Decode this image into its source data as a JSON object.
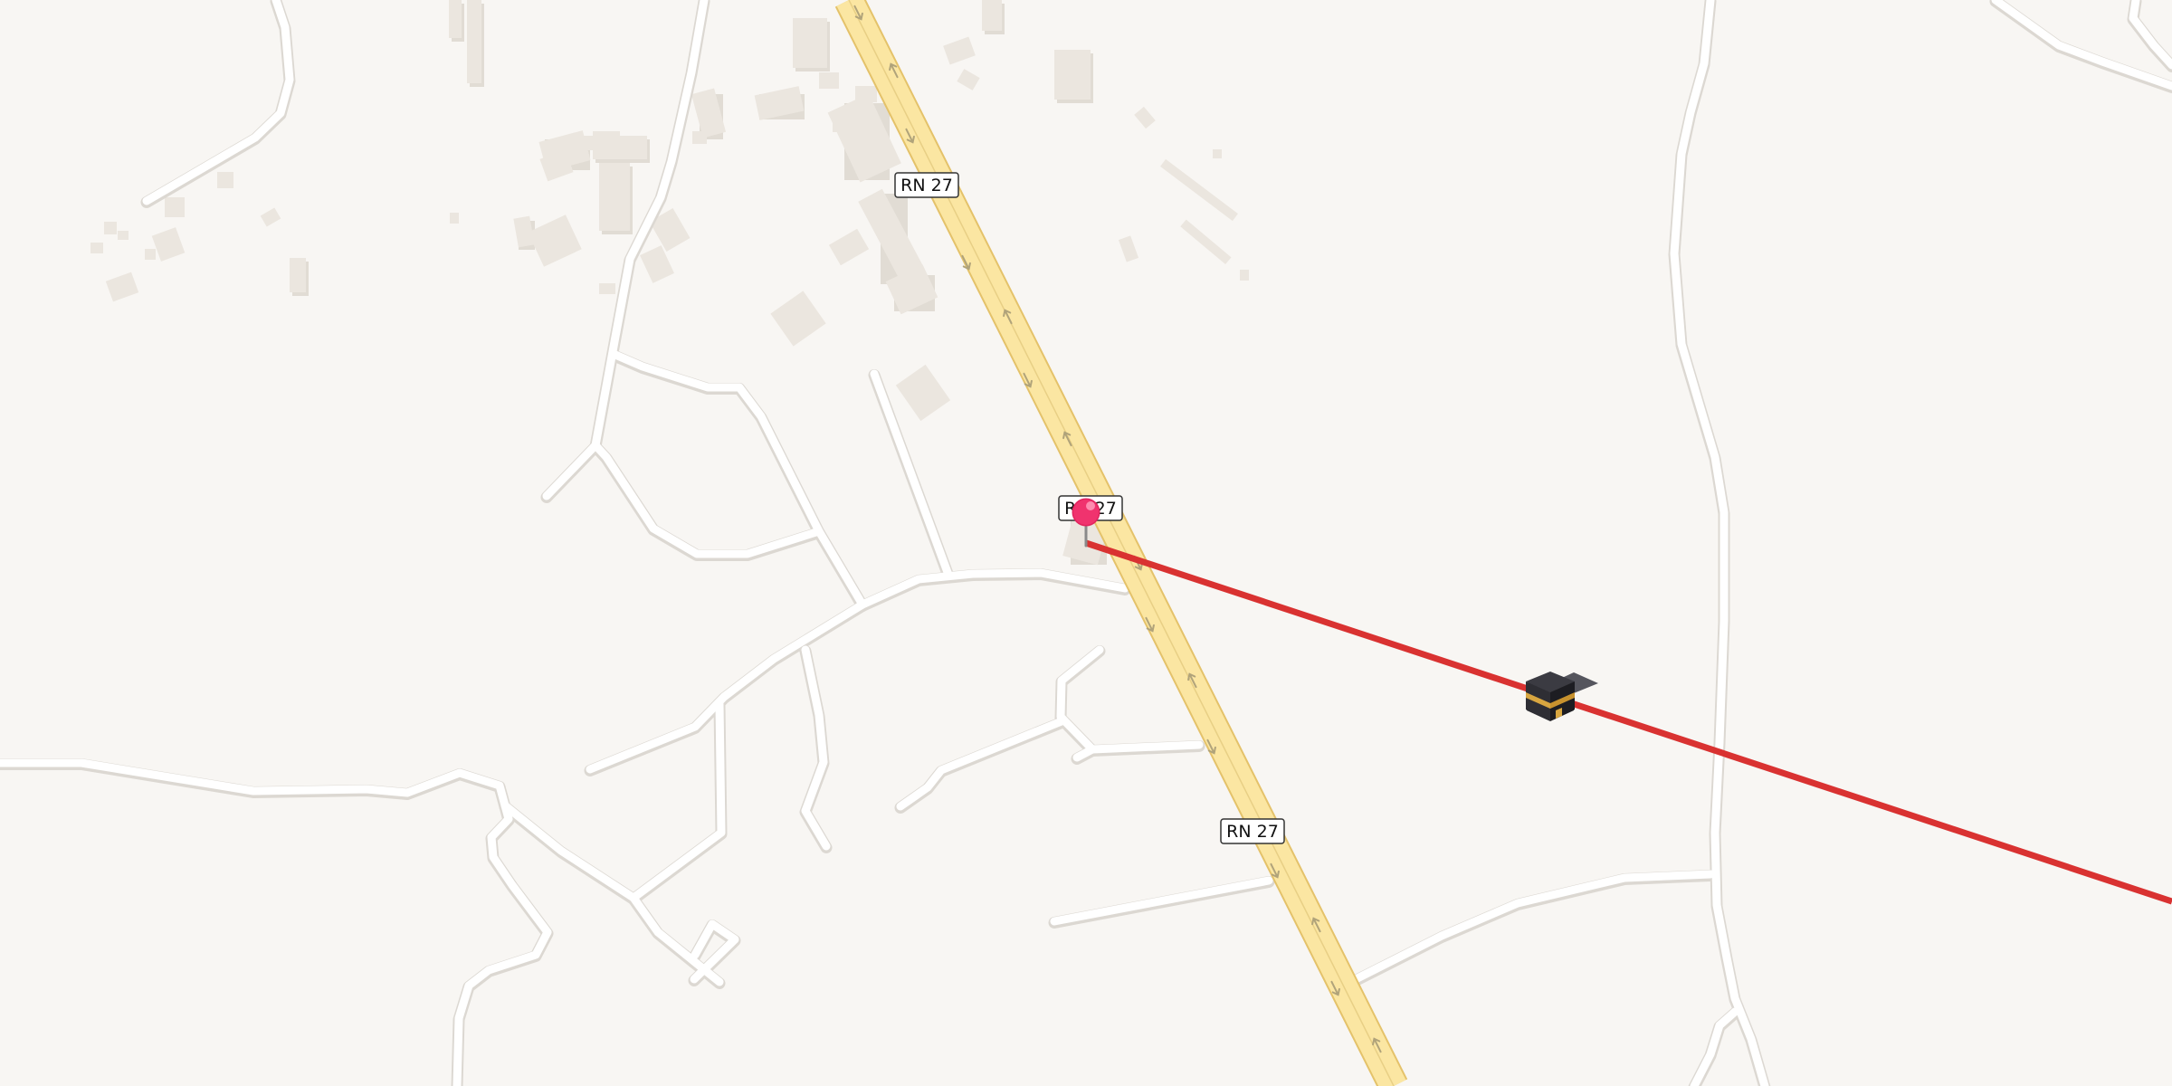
{
  "map": {
    "background_color": "#f8f6f3",
    "minor_road_color": "#ffffff",
    "highway_color": "#fbe6a2",
    "highway_casing_color": "#e4c26a",
    "building_color": "#ebe6df"
  },
  "highway": {
    "name": "RN 27",
    "labels": [
      "RN 27",
      "RN 27",
      "RN 27"
    ]
  },
  "qibla_line": {
    "color": "#d93231"
  },
  "markers": {
    "pin": {
      "icon": "location-pin-icon",
      "color": "#f0336e"
    },
    "kaaba": {
      "icon": "kaaba-icon",
      "color": "#2b2b30",
      "band_color": "#d8a640"
    }
  }
}
